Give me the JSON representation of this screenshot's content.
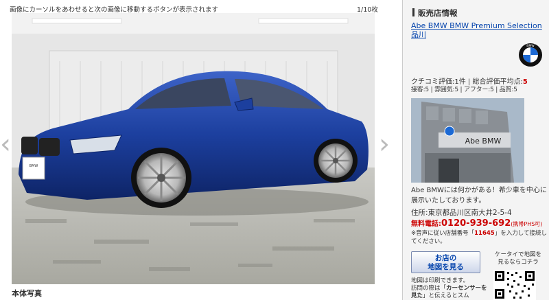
{
  "gallery": {
    "hint": "画像にカーソルをあわせると次の画像に移動するボタンが表示されます",
    "counter": "1/10枚",
    "prev_arrow": "‹",
    "next_arrow": "›",
    "caption": "本体写真",
    "photo_plate_text": "BMW Premium Selection"
  },
  "dealer": {
    "section_title": "販売店情報",
    "name": "Abe BMW BMW Premium Selection 品川",
    "logo_letters": "BMW",
    "rating_line_label": "クチコミ評価:",
    "rating_count": "1件",
    "rating_avg_label": " | 総合評価平均点:",
    "rating_avg": "5",
    "rating_detail": "接客:5 | 雰囲気:5 | アフター:5 | 品質:5",
    "photo_sign": "Abe BMW",
    "description": "Abe BMWには何かがある！希少車を中心に展示いたしております。",
    "address": "住所:東京都品川区南大井2-5-4",
    "phone_label": "無料電話:",
    "phone_number": "0120-939-692",
    "phone_note": "(携帯PHS可)",
    "guide_prefix": "※音声に従い店舗番号「",
    "shop_number": "11645",
    "guide_suffix": "」を入力して接続してください。",
    "map_button_line1": "お店の",
    "map_button_line2": "地図を見る",
    "mobile_line1": "ケータイで地図を",
    "mobile_line2": "見るならコチラ",
    "print_note_1": "地図は印刷できます。",
    "print_note_2": "訪問の際は「",
    "print_note_bold": "カーセンサーを見た",
    "print_note_3": "」と伝えるとスム"
  },
  "colors": {
    "link": "#0645ad",
    "accent_red": "#cc0000",
    "panel_bg": "#f4f4f4",
    "car_blue": "#1c3f9e"
  }
}
